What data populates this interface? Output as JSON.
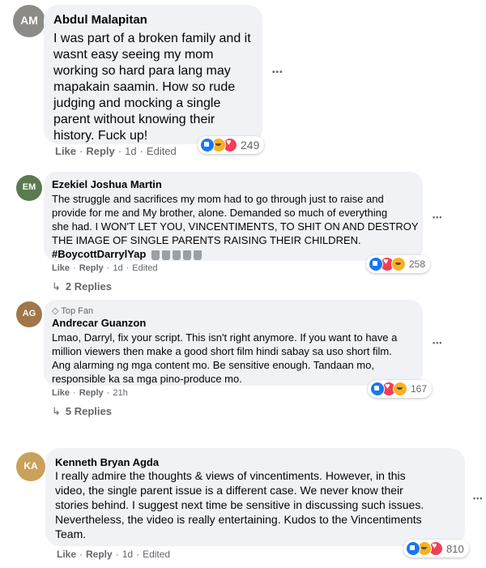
{
  "comments": [
    {
      "author": "Abdul Malapitan",
      "avatar_initials": "AM",
      "avatar_color": "#8d8b88",
      "text": "I was part of a broken family and it\nwasnt easy seeing my mom\nworking so hard para lang may\nmapakain saamin. How so rude\njudging and mocking a single\nparent without knowing their\nhistory. Fuck up!",
      "like_label": "Like",
      "reply_label": "Reply",
      "time": "1d",
      "edited": "Edited",
      "reaction_count": "249",
      "reaction_icons": [
        "like-icon",
        "sad-icon",
        "love-icon"
      ]
    },
    {
      "author": "Ezekiel Joshua Martin",
      "avatar_initials": "EM",
      "avatar_color": "#5b7a4f",
      "text": "The struggle and sacrifices my mom had to go through just to raise and\nprovide for me and My brother, alone. Demanded so much of everything\nshe had. I WON'T LET YOU, VINCENTIMENTS, TO SHIT ON AND DESTROY\nTHE IMAGE OF SINGLE PARENTS RAISING THEIR CHILDREN.",
      "hashtag": "#BoycottDarrylYap",
      "hashtag_icons": [
        "trash-icon",
        "trash-icon",
        "trash-icon",
        "trash-icon",
        "trash-icon"
      ],
      "like_label": "Like",
      "reply_label": "Reply",
      "time": "1d",
      "edited": "Edited",
      "reaction_count": "258",
      "reaction_icons": [
        "like-icon",
        "love-icon",
        "sad-icon"
      ],
      "replies_label": "2 Replies"
    },
    {
      "badge": "Top Fan",
      "author": "Andrecar Guanzon",
      "avatar_initials": "AG",
      "avatar_color": "#a0764a",
      "text": "Lmao, Darryl, fix your script. This isn't right anymore. If you want to have a\nmillion viewers then make a good short film hindi sabay sa uso short film.\nAng alarming ng mga content mo. Be sensitive enough. Tandaan mo,\nresponsible ka sa mga pino-produce mo.",
      "like_label": "Like",
      "reply_label": "Reply",
      "time": "21h",
      "reaction_count": "167",
      "reaction_icons": [
        "like-icon",
        "love-icon",
        "haha-icon"
      ],
      "replies_label": "5 Replies"
    },
    {
      "author": "Kenneth Bryan Agda",
      "avatar_initials": "KA",
      "avatar_color": "#c9a15a",
      "text": "I really admire the thoughts & views of vincentiments. However, in this\nvideo, the single parent issue is a different case. We never know their\nstories behind. I suggest next time be sensitive in discussing such issues.\nNevertheless, the video is really entertaining. Kudos to the Vincentiments\nTeam.",
      "like_label": "Like",
      "reply_label": "Reply",
      "time": "1d",
      "edited": "Edited",
      "reaction_count": "810",
      "reaction_icons": [
        "like-icon",
        "sad-icon",
        "love-icon"
      ]
    }
  ],
  "more_label": "•••",
  "sep": "·"
}
